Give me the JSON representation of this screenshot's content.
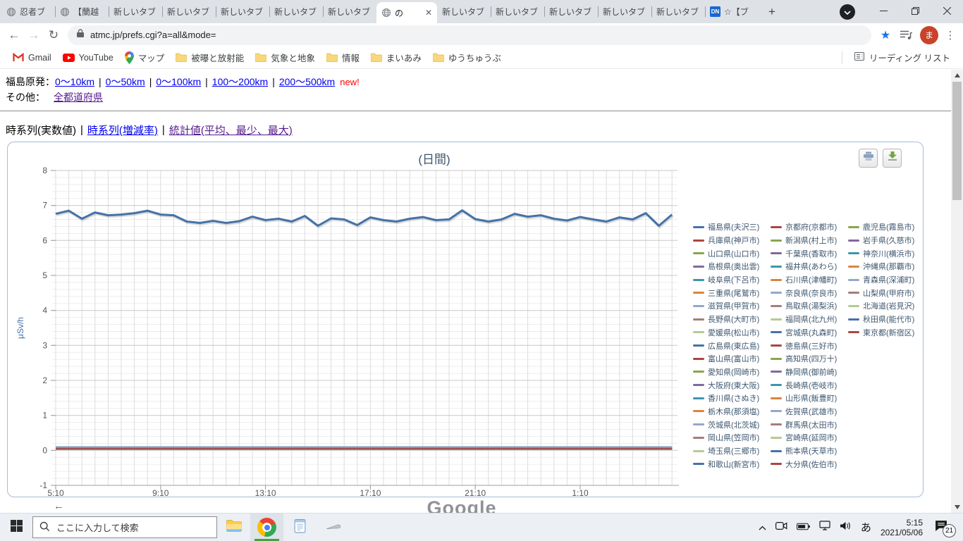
{
  "browser": {
    "tabs": [
      {
        "label": "忍者ブ",
        "favicon": "globe"
      },
      {
        "label": "【蘭越",
        "favicon": "globe"
      },
      {
        "label": "新しいタブ"
      },
      {
        "label": "新しいタブ"
      },
      {
        "label": "新しいタブ"
      },
      {
        "label": "新しいタブ"
      },
      {
        "label": "新しいタブ"
      },
      {
        "label": "の",
        "favicon": "globe",
        "active": true
      },
      {
        "label": "新しいタブ"
      },
      {
        "label": "新しいタブ"
      },
      {
        "label": "新しいタブ"
      },
      {
        "label": "新しいタブ"
      },
      {
        "label": "新しいタブ"
      },
      {
        "label": "☆【ブ",
        "favicon": "dn"
      }
    ],
    "new_tab_plus": "+",
    "address": "atmc.jp/prefs.cgi?a=all&mode=",
    "avatar_letter": "ま",
    "bookmarks": [
      {
        "label": "Gmail",
        "icon": "gmail"
      },
      {
        "label": "YouTube",
        "icon": "youtube"
      },
      {
        "label": "マップ",
        "icon": "maps-pin"
      },
      {
        "label": "被曝と放射能",
        "icon": "folder"
      },
      {
        "label": "気象と地象",
        "icon": "folder"
      },
      {
        "label": "情報",
        "icon": "folder"
      },
      {
        "label": "まいあみ",
        "icon": "folder"
      },
      {
        "label": "ゆうちゅうぶ",
        "icon": "folder"
      }
    ],
    "reading_list": "リーディング リスト"
  },
  "page": {
    "link_rows": [
      {
        "label": "福島原発：",
        "links": [
          {
            "text": "0〜10km"
          },
          {
            "text": "0〜50km"
          },
          {
            "text": "0〜100km"
          },
          {
            "text": "100〜200km"
          },
          {
            "text": "200〜500km"
          }
        ],
        "suffix": "new!"
      },
      {
        "label": "その他：",
        "links": [
          {
            "text": "全都道府県",
            "visited": true
          }
        ]
      }
    ],
    "separator": "|",
    "view_tabs": [
      {
        "label": "時系列(実数値)",
        "type": "current"
      },
      {
        "label": "時系列(増減率)",
        "type": "link"
      },
      {
        "label": "統計値(平均、最少、最大)",
        "type": "visited"
      }
    ],
    "back_arrow": "←",
    "partial_ad_text": "Google"
  },
  "chart_data": {
    "type": "line",
    "title": "(日間)",
    "ylabel": "μSv/h",
    "ylim": [
      -1,
      8
    ],
    "y_major_step": 1,
    "y_minor_step": 0.2,
    "x_minutes_step": 30,
    "x_tick_labels": [
      "5:10",
      "9:10",
      "13:10",
      "17:10",
      "21:10",
      "1:10"
    ],
    "x_tick_indices": [
      0,
      8,
      16,
      24,
      32,
      40
    ],
    "grid": true,
    "legend_position": "right",
    "palette": [
      "#4572A7",
      "#AA4643",
      "#89A54E",
      "#80699B",
      "#3D96AE",
      "#DB843D",
      "#92A8CD",
      "#A47D7C",
      "#B5CA92"
    ],
    "series": [
      {
        "name": "福島県(夫沢三)",
        "values": [
          6.76,
          6.85,
          6.62,
          6.8,
          6.72,
          6.74,
          6.78,
          6.85,
          6.74,
          6.72,
          6.54,
          6.5,
          6.56,
          6.5,
          6.55,
          6.68,
          6.58,
          6.62,
          6.54,
          6.7,
          6.42,
          6.63,
          6.6,
          6.44,
          6.66,
          6.58,
          6.54,
          6.62,
          6.67,
          6.58,
          6.6,
          6.86,
          6.61,
          6.54,
          6.6,
          6.76,
          6.68,
          6.72,
          6.62,
          6.57,
          6.67,
          6.6,
          6.54,
          6.66,
          6.6,
          6.78,
          6.42,
          6.74
        ]
      },
      {
        "name": "兵庫県(神戸市)",
        "approx": 0.06
      },
      {
        "name": "山口県(山口市)",
        "approx": 0.08
      },
      {
        "name": "島根県(奥出雲)",
        "approx": 0.05
      },
      {
        "name": "岐阜県(下呂市)",
        "approx": 0.06
      },
      {
        "name": "三重県(尾鷲市)",
        "approx": 0.05
      },
      {
        "name": "滋賀県(甲賀市)",
        "approx": 0.06
      },
      {
        "name": "長野県(大町市)",
        "approx": 0.04
      },
      {
        "name": "愛媛県(松山市)",
        "approx": 0.05
      },
      {
        "name": "広島県(東広島)",
        "approx": 0.05
      },
      {
        "name": "富山県(富山市)",
        "approx": 0.06
      },
      {
        "name": "愛知県(岡崎市)",
        "approx": 0.04
      },
      {
        "name": "大阪府(東大阪)",
        "approx": 0.06
      },
      {
        "name": "香川県(さぬき)",
        "approx": 0.06
      },
      {
        "name": "栃木県(那須塩)",
        "approx": 0.08
      },
      {
        "name": "茨城県(北茨城)",
        "approx": 0.1
      },
      {
        "name": "岡山県(笠岡市)",
        "approx": 0.07
      },
      {
        "name": "埼玉県(三郷市)",
        "approx": 0.06
      },
      {
        "name": "和歌山(新宮市)",
        "approx": 0.04
      },
      {
        "name": "京都府(京都市)",
        "approx": 0.05
      },
      {
        "name": "新潟県(村上市)",
        "approx": 0.05
      },
      {
        "name": "千葉県(香取市)",
        "approx": 0.04
      },
      {
        "name": "福井県(あわら)",
        "approx": 0.07
      },
      {
        "name": "石川県(津幡町)",
        "approx": 0.05
      },
      {
        "name": "奈良県(奈良市)",
        "approx": 0.06
      },
      {
        "name": "鳥取県(湯梨浜)",
        "approx": 0.07
      },
      {
        "name": "福岡県(北九州)",
        "approx": 0.05
      },
      {
        "name": "宮城県(丸森町)",
        "approx": 0.07
      },
      {
        "name": "徳島県(三好市)",
        "approx": 0.06
      },
      {
        "name": "高知県(四万十)",
        "approx": 0.05
      },
      {
        "name": "静岡県(御前崎)",
        "approx": 0.04
      },
      {
        "name": "長崎県(壱岐市)",
        "approx": 0.06
      },
      {
        "name": "山形県(飯豊町)",
        "approx": 0.05
      },
      {
        "name": "佐賀県(武雄市)",
        "approx": 0.05
      },
      {
        "name": "群馬県(太田市)",
        "approx": 0.04
      },
      {
        "name": "宮崎県(延岡市)",
        "approx": 0.04
      },
      {
        "name": "熊本県(天草市)",
        "approx": 0.05
      },
      {
        "name": "大分県(佐伯市)",
        "approx": 0.06
      },
      {
        "name": "鹿児島(霧島市)",
        "approx": 0.07
      },
      {
        "name": "岩手県(久慈市)",
        "approx": 0.03
      },
      {
        "name": "神奈川(横浜市)",
        "approx": 0.05
      },
      {
        "name": "沖縄県(那覇市)",
        "approx": 0.06
      },
      {
        "name": "青森県(深浦町)",
        "approx": 0.03
      },
      {
        "name": "山梨県(甲府市)",
        "approx": 0.05
      },
      {
        "name": "北海道(岩見沢)",
        "approx": 0.03
      },
      {
        "name": "秋田県(能代市)",
        "approx": 0.04
      },
      {
        "name": "東京都(新宿区)",
        "approx": 0.04
      }
    ]
  },
  "taskbar": {
    "search_placeholder": "ここに入力して検索",
    "ime": "あ",
    "time": "5:15",
    "date": "2021/05/06",
    "notification_count": "21"
  }
}
